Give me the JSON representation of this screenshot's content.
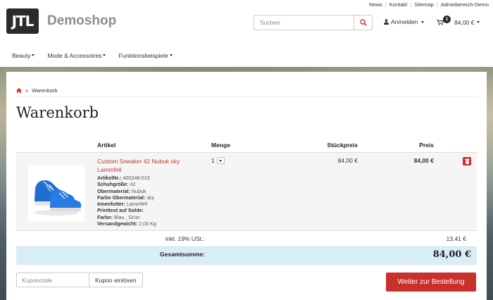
{
  "topbar": {
    "links": [
      "News",
      "Kontakt",
      "Sitemap",
      "Adminbereich-Demo"
    ]
  },
  "header": {
    "logo_text": "JTL",
    "brand": "Demoshop",
    "search_placeholder": "Suchen",
    "login_label": "Anmelden",
    "cart_count": "1",
    "cart_total": "84,00 €"
  },
  "nav": {
    "items": [
      "Beauty",
      "Mode & Accessoires",
      "Funktionsbeispiele"
    ]
  },
  "breadcrumb": {
    "current": "Warenkorb"
  },
  "page_title": "Warenkorb",
  "table": {
    "headers": {
      "artikel": "Artikel",
      "menge": "Menge",
      "stueckpreis": "Stückpreis",
      "preis": "Preis"
    },
    "item": {
      "name": "Custom Sneaker 42 Nubuk sky Lammfell",
      "attributes": [
        {
          "label": "ArtikelNr.:",
          "value": "400248-019"
        },
        {
          "label": "Schuhgröße:",
          "value": "42"
        },
        {
          "label": "Obermaterial:",
          "value": "Nubuk"
        },
        {
          "label": "Farbe Obermaterial:",
          "value": "sky"
        },
        {
          "label": "Innenfutter:",
          "value": "Lammfell"
        },
        {
          "label": "Printtext auf Sohle:",
          "value": ""
        },
        {
          "label": "Farbe:",
          "value": "Blau , Grün"
        },
        {
          "label": "Versandgewicht:",
          "value": "2,00 Kg"
        }
      ],
      "quantity": "1",
      "unit_price": "84,00 €",
      "price": "84,00 €"
    },
    "vat_label": "inkl. 19% USt.:",
    "vat_value": "13,41 €",
    "total_label": "Gesamtsumme:",
    "total_value": "84,00 €"
  },
  "coupon": {
    "placeholder": "Kuponcode",
    "button": "Kupon einlösen"
  },
  "checkout_button": "Weiter zur Bestellung",
  "colors": {
    "accent": "#c9302c",
    "total_bg": "#d9edf7",
    "logo_bg": "#2b2b2b"
  }
}
